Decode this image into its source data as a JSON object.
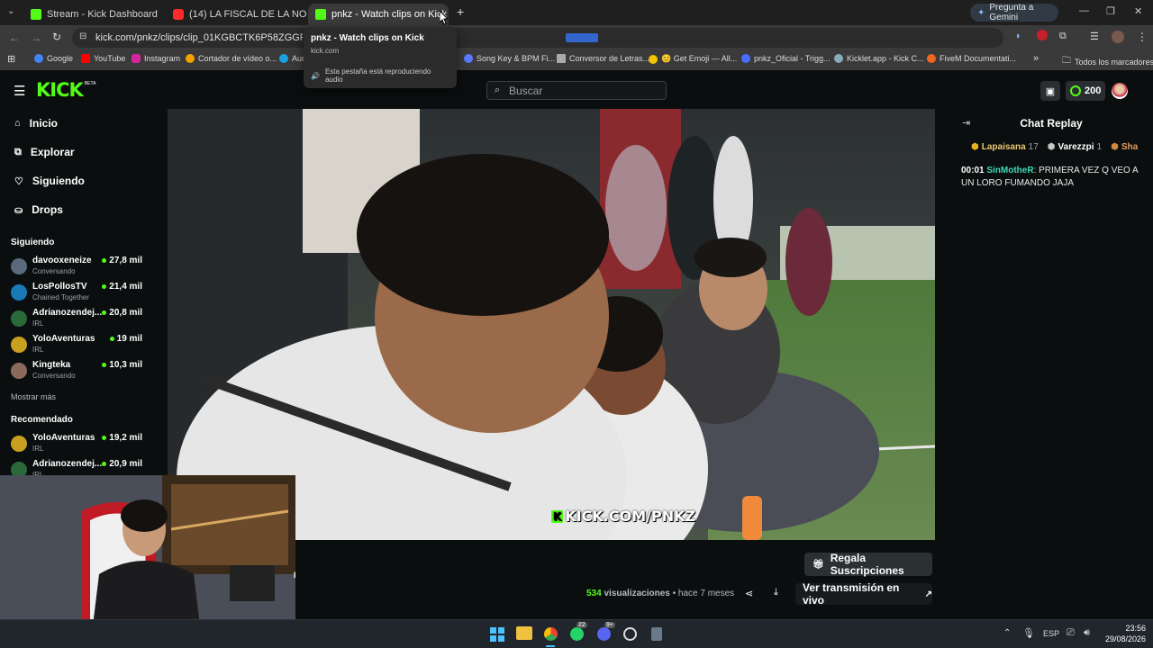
{
  "browser": {
    "tabs": [
      {
        "title": "Stream - Kick Dashboard",
        "active": false
      },
      {
        "title": "(14) LA FISCAL DE LA NOCHE -",
        "active": false
      },
      {
        "title": "pnkz - Watch clips on Kick",
        "active": true
      }
    ],
    "gemini_label": "Pregunta a Gemini",
    "url": "kick.com/pnkz/clips/clip_01KGBCTK6P58ZGGRJ11AQXBY",
    "tooltip": {
      "title": "pnkz - Watch clips on Kick",
      "domain": "kick.com",
      "audio_text": "Esta pestaña está reproduciendo audio"
    },
    "bookmarks": [
      {
        "label": "Google"
      },
      {
        "label": "YouTube"
      },
      {
        "label": "Instagram"
      },
      {
        "label": "Cortador de vídeo o..."
      },
      {
        "label": "Aud"
      },
      {
        "label": "Song Key & BPM Fi..."
      },
      {
        "label": "Conversor de Letras..."
      },
      {
        "label": "😊 Get Emoji — All..."
      },
      {
        "label": "pnkz_Oficial - Trigg..."
      },
      {
        "label": "Kicklet.app - Kick C..."
      },
      {
        "label": "FiveM Documentati..."
      }
    ],
    "all_bookmarks": "Todos los marcadores"
  },
  "kick": {
    "logo": "KICK",
    "logo_badge": "BETA",
    "search_placeholder": "Buscar",
    "points": "200",
    "nav": [
      {
        "label": "Inicio"
      },
      {
        "label": "Explorar"
      },
      {
        "label": "Siguiendo"
      },
      {
        "label": "Drops"
      }
    ],
    "following_title": "Siguiendo",
    "following": [
      {
        "name": "davooxeneize",
        "category": "Conversando",
        "viewers": "27,8 mil"
      },
      {
        "name": "LosPollosTV",
        "category": "Chained Together",
        "viewers": "21,4 mil"
      },
      {
        "name": "Adrianozendej...",
        "category": "IRL",
        "viewers": "20,8 mil"
      },
      {
        "name": "YoloAventuras",
        "category": "IRL",
        "viewers": "19 mil"
      },
      {
        "name": "Kingteka",
        "category": "Conversando",
        "viewers": "10,3 mil"
      }
    ],
    "show_more": "Mostrar más",
    "recommended_title": "Recomendado",
    "recommended": [
      {
        "name": "YoloAventuras",
        "category": "IRL",
        "viewers": "19,2 mil"
      },
      {
        "name": "Adrianozendej...",
        "category": "IRL",
        "viewers": "20,9 mil"
      }
    ],
    "video_watermark": "KICK.COM/PNKZ",
    "gift_subs": "Regala Suscripciones",
    "views_count": "534",
    "views_label": "visualizaciones",
    "time_ago": "hace 7 meses",
    "watch_live": "Ver transmisión en vivo",
    "chat": {
      "title": "Chat Replay",
      "top_gifters": [
        {
          "name": "Lapaisana",
          "count": "17"
        },
        {
          "name": "Varezzpi",
          "count": "1"
        },
        {
          "name": "Sha",
          "count": ""
        }
      ],
      "messages": [
        {
          "time": "00:01",
          "user": "SinMotheR",
          "text": "PRIMERA VEZ Q VEO A UN LORO FUMANDO JAJA"
        }
      ]
    }
  },
  "taskbar": {
    "whatsapp_badge": "22",
    "discord_badge": "9+",
    "lang": "ESP",
    "time": "23:56",
    "date": "29/08/2026"
  },
  "webcam_overlay_text": "IA",
  "colors": {
    "kick_green": "#53fc18",
    "chat_user": "#3fd9b5"
  }
}
